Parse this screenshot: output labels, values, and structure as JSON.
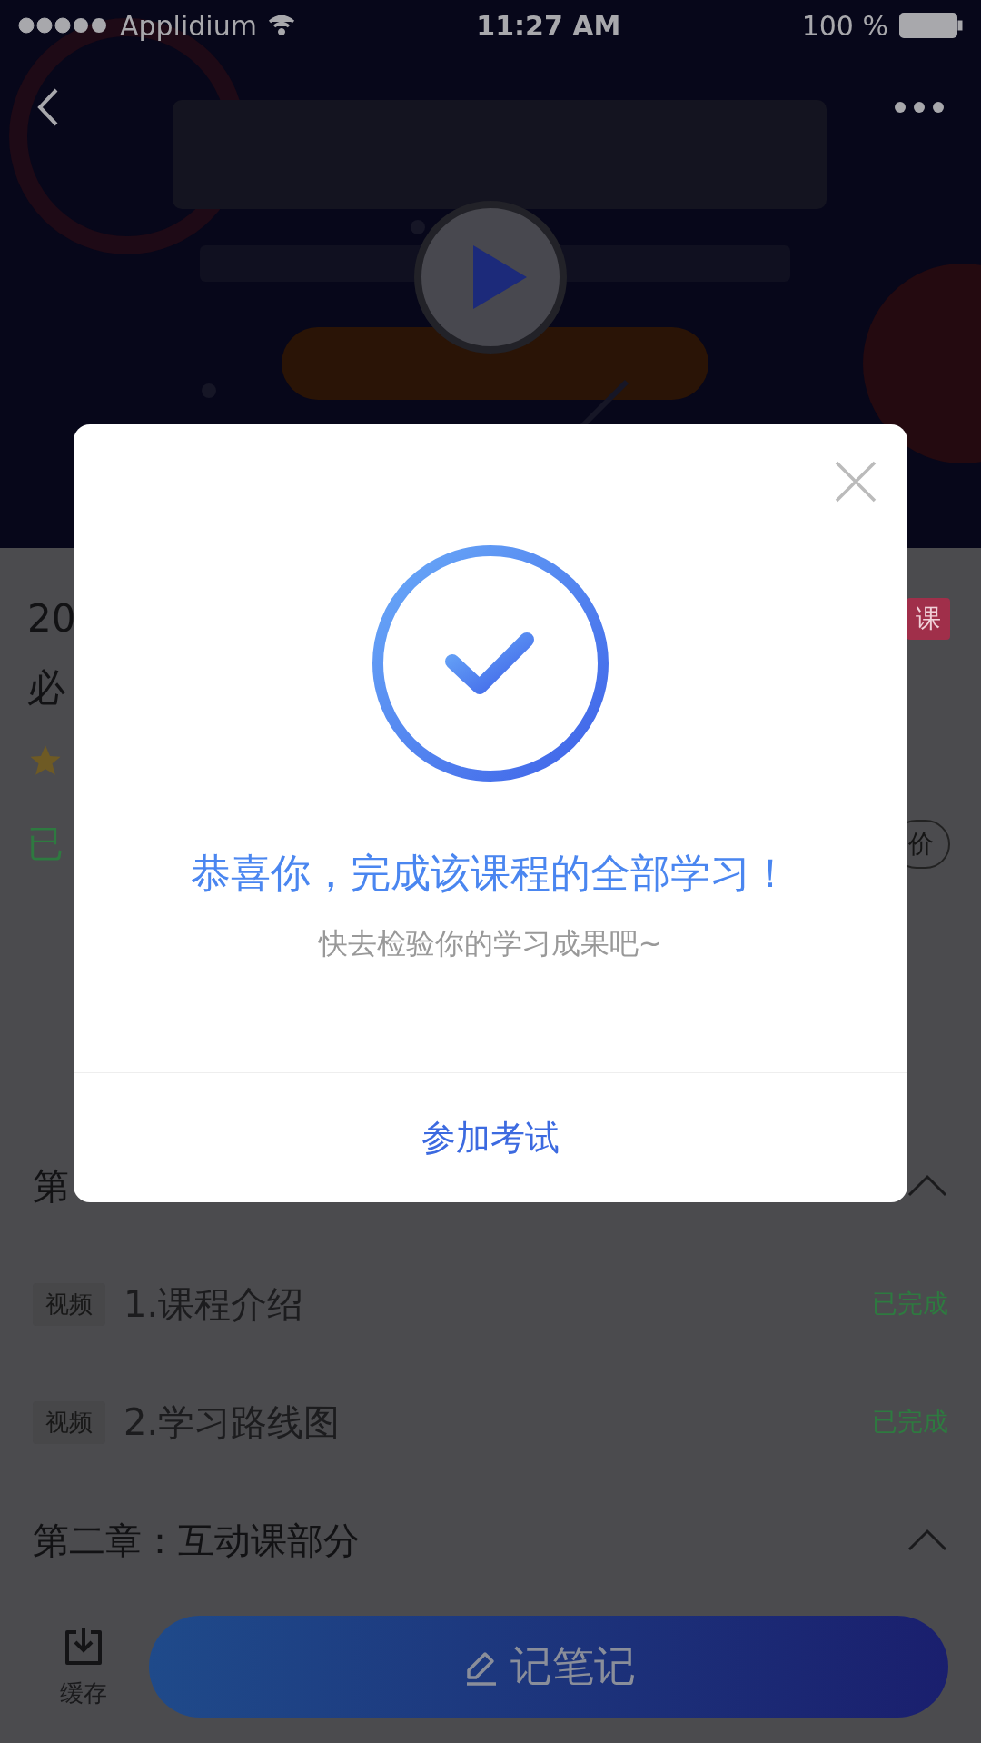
{
  "status_bar": {
    "carrier": "Applidium",
    "time": "11:27 AM",
    "battery": "100 %"
  },
  "course": {
    "title_line_1": "20",
    "title_line_2": "必",
    "tag": "课",
    "progress": "已",
    "intro_button": "价"
  },
  "chapters": [
    {
      "title": "第",
      "expanded": true,
      "lessons": [
        {
          "tag": "视频",
          "title": "1.课程介绍",
          "status": "已完成"
        },
        {
          "tag": "视频",
          "title": "2.学习路线图",
          "status": "已完成"
        }
      ]
    },
    {
      "title": "第二章：互动课部分",
      "expanded": true
    }
  ],
  "bottom_bar": {
    "cache_label": "缓存",
    "note_button": "记笔记"
  },
  "dialog": {
    "title": "恭喜你，完成该课程的全部学习！",
    "subtitle": "快去检验你的学习成果吧~",
    "action": "参加考试"
  }
}
